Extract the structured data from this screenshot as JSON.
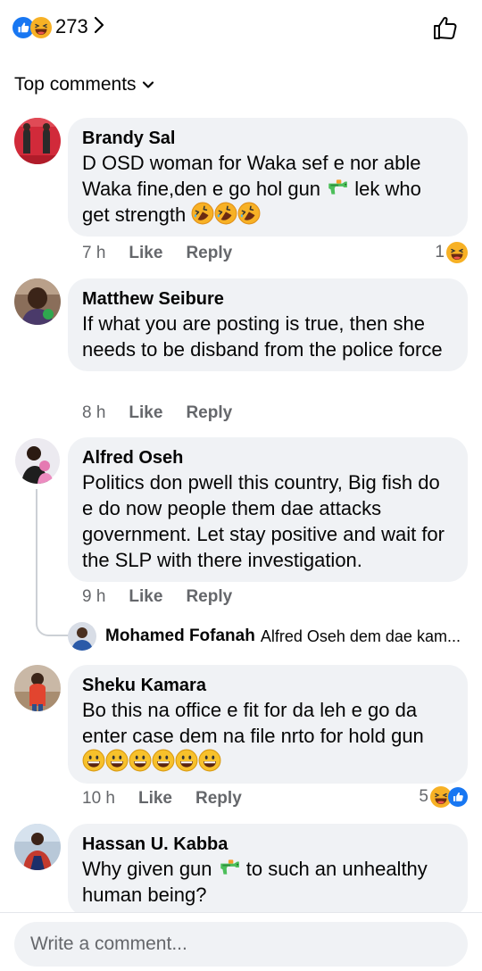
{
  "header": {
    "reaction_count": "273",
    "reaction_icons": [
      "like-icon",
      "haha-icon"
    ],
    "like_button_icon": "thumbs-up-outline-icon"
  },
  "sort": {
    "label": "Top comments"
  },
  "comments": [
    {
      "author": "Brandy Sal",
      "text_parts": [
        "D OSD woman for Waka sef e nor able Waka fine,den e go hol gun ",
        " lek who get strength "
      ],
      "emoji_inline": [
        "water-pistol-emoji",
        "rofl-emoji",
        "rofl-emoji",
        "rofl-emoji"
      ],
      "time": "7 h",
      "like": "Like",
      "reply": "Reply",
      "reactions": {
        "count": "1",
        "icons": [
          "haha-icon"
        ]
      }
    },
    {
      "author": "Matthew Seibure",
      "text": "If what you are posting is true, then she needs to be disband from the police force",
      "time": "8 h",
      "like": "Like",
      "reply": "Reply"
    },
    {
      "author": "Alfred Oseh",
      "text": "Politics don pwell this country, Big fish do e do now people them dae attacks government. Let stay positive and wait for the SLP with there investigation.",
      "time": "9 h",
      "like": "Like",
      "reply": "Reply",
      "reply_preview": {
        "author": "Mohamed Fofanah",
        "text": "Alfred Oseh dem dae kam..."
      }
    },
    {
      "author": "Sheku Kamara",
      "text": "Bo this na office e fit for da leh e go da enter case dem na file nrto for hold gun",
      "emoji_inline": [
        "grinning-emoji",
        "grinning-emoji",
        "grinning-emoji",
        "grinning-emoji",
        "grinning-emoji",
        "grinning-emoji"
      ],
      "time": "10 h",
      "like": "Like",
      "reply": "Reply",
      "reactions": {
        "count": "5",
        "icons": [
          "haha-icon",
          "like-icon"
        ]
      }
    },
    {
      "author": "Hassan U. Kabba",
      "text_parts": [
        "Why given gun ",
        " to such an unhealthy human being?"
      ],
      "emoji_inline": [
        "water-pistol-emoji"
      ]
    }
  ],
  "composer": {
    "placeholder": "Write a comment..."
  },
  "colors": {
    "bubble": "#f0f2f5",
    "meta_text": "#65676b",
    "like_blue": "#1877f2",
    "haha_yellow": "#f7b125"
  }
}
